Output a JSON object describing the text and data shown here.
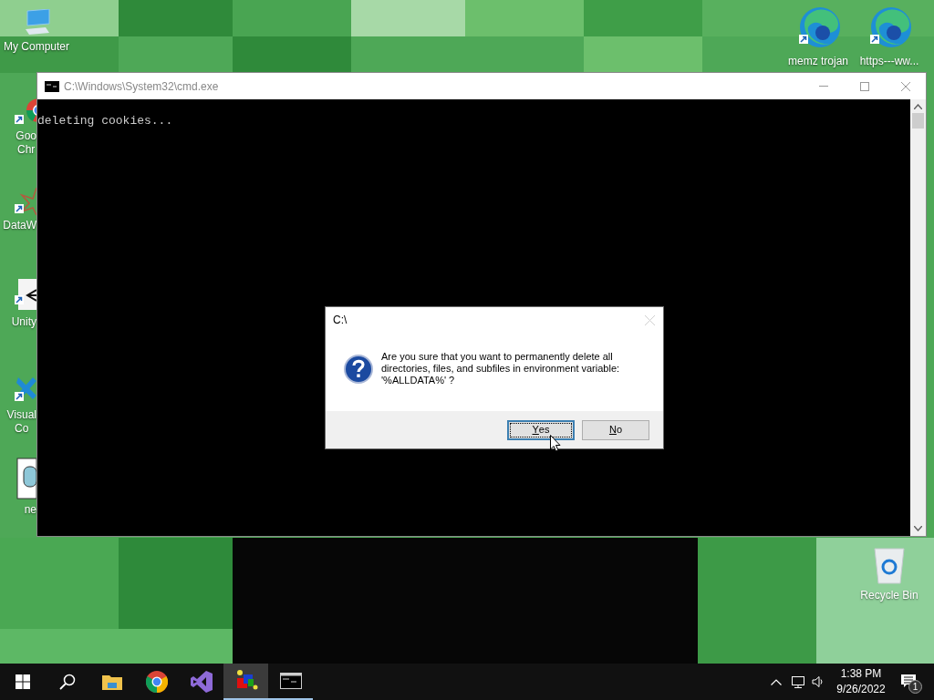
{
  "desktop": {
    "left_icons": [
      {
        "kind": "computer",
        "label_lines": [
          "My Computer"
        ]
      },
      {
        "kind": "chrome",
        "label_lines": [
          "Goo",
          "Chr"
        ]
      },
      {
        "kind": "star",
        "label_lines": [
          "DataW"
        ]
      },
      {
        "kind": "unity",
        "label_lines": [
          "Unity"
        ]
      },
      {
        "kind": "vscode",
        "label_lines": [
          "Visual",
          "Co"
        ]
      },
      {
        "kind": "document",
        "label_lines": [
          "ne"
        ]
      }
    ],
    "right_icons": [
      {
        "kind": "edge",
        "label_lines": [
          "memz trojan"
        ]
      },
      {
        "kind": "edge",
        "label_lines": [
          "https---ww..."
        ]
      },
      {
        "kind": "recycle",
        "label_lines": [
          "Recycle Bin"
        ]
      }
    ]
  },
  "cmd_window": {
    "title": "C:\\Windows\\System32\\cmd.exe",
    "output": [
      "deleting cookies..."
    ]
  },
  "dialog": {
    "title": "C:\\",
    "close_disabled": true,
    "message_lines": [
      "Are you sure that you want to permanently delete all",
      "directories, files, and subfiles in environment variable:",
      "'%ALLDATA%' ?"
    ],
    "buttons": [
      {
        "label": "Yes",
        "default": true
      },
      {
        "label": "No",
        "default": false
      }
    ]
  },
  "taskbar": {
    "apps": [
      {
        "kind": "start",
        "running": false,
        "highlighted": false
      },
      {
        "kind": "search",
        "running": false,
        "highlighted": false
      },
      {
        "kind": "folder",
        "running": false,
        "highlighted": false
      },
      {
        "kind": "chrome",
        "running": false,
        "highlighted": false
      },
      {
        "kind": "studio",
        "running": false,
        "highlighted": false
      },
      {
        "kind": "cubes",
        "running": true,
        "highlighted": true
      },
      {
        "kind": "console",
        "running": true,
        "highlighted": false
      }
    ],
    "clock": {
      "time": "1:38 PM",
      "date": "9/26/2022"
    },
    "notifications": {
      "count": "1"
    }
  }
}
